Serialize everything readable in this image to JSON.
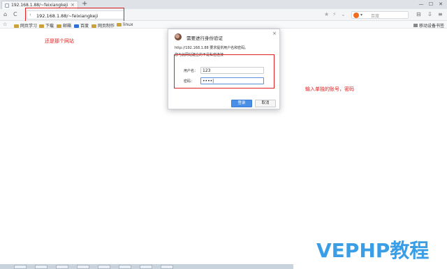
{
  "tab": {
    "title": "192.168.1.88/~feixiangkeji",
    "close": "×",
    "new_tab": "+"
  },
  "window": {
    "minimize": "—",
    "maximize": "☐",
    "close": "✕"
  },
  "nav": {
    "back": "⌂",
    "refresh": "C",
    "forward": "‹"
  },
  "address": {
    "url": "192.168.1.88/~feixiangkeji"
  },
  "search": {
    "placeholder": "百度"
  },
  "bookmarks": {
    "items": [
      "网页学习",
      "下载",
      "邮箱",
      "百度",
      "网页制作",
      "linux"
    ],
    "right": "移动设备书签"
  },
  "annotations": {
    "url_note": "还是那个网站",
    "fields_note": "输入单独的账号，密码"
  },
  "dialog": {
    "heading": "需要进行身份验证",
    "close": "×",
    "message": "http://192.168.1.88 要求提供用户名和密码。",
    "message2": "您与此网站建立的不是私密连接",
    "username_label": "用户名：",
    "username_value": "123",
    "password_label": "密码：",
    "password_value": "••••|",
    "ok_label": "登录",
    "cancel_label": "取消"
  },
  "watermark": "VEPHP教程",
  "colors": {
    "annotation": "#e02020",
    "primary_button": "#4a8fe7",
    "watermark": "#3a9ee6"
  }
}
